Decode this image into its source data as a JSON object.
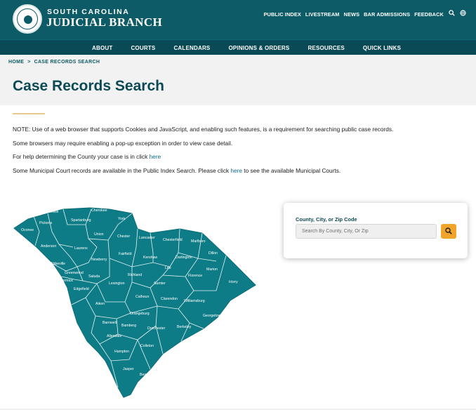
{
  "header": {
    "brand_top": "SOUTH CAROLINA",
    "brand_main": "JUDICIAL BRANCH",
    "utility_links": [
      "PUBLIC INDEX",
      "LIVESTREAM",
      "NEWS",
      "BAR ADMISSIONS",
      "FEEDBACK"
    ],
    "icons": [
      "search-icon",
      "globe-icon"
    ]
  },
  "nav": {
    "items": [
      "ABOUT",
      "COURTS",
      "CALENDARS",
      "OPINIONS & ORDERS",
      "RESOURCES",
      "QUICK LINKS"
    ]
  },
  "breadcrumb": {
    "home": "HOME",
    "separator": ">",
    "current": "CASE RECORDS SEARCH"
  },
  "page": {
    "title": "Case Records Search"
  },
  "notes": {
    "note1": "NOTE: Use of a web browser that supports Cookies and JavaScript, and enabling such features, is a requirement for searching public case records.",
    "note2": "Some browsers may require enabling a pop-up exception in order to view case detail.",
    "note3_text": "For help determining the County your case is in click ",
    "note3_link": "here",
    "note4_text": "Some Municipal Court records are available in the Public Index Search. Please click ",
    "note4_link": "here",
    "note4_tail": " to see the available Municipal Courts."
  },
  "map": {
    "counties": [
      "Greenville",
      "Cherokee",
      "Pickens",
      "Spartanburg",
      "York",
      "Oconee",
      "Union",
      "Chester",
      "Lancaster",
      "Chesterfield",
      "Marlboro",
      "Anderson",
      "Laurens",
      "Fairfield",
      "Kershaw",
      "Darlington",
      "Dillon",
      "Newberry",
      "Lee",
      "Marion",
      "Abbeville",
      "Greenwood",
      "Saluda",
      "Richland",
      "Florence",
      "McCormick",
      "Lexington",
      "Sumter",
      "Horry",
      "Edgefield",
      "Calhoun",
      "Clarendon",
      "Williamsburg",
      "Aiken",
      "Orangeburg",
      "Georgetown",
      "Barnwell",
      "Bamberg",
      "Dorchester",
      "Berkeley",
      "Allendale",
      "Colleton",
      "Charleston",
      "Hampton",
      "Jasper",
      "Beaufort"
    ],
    "fill_color": "#0e7c86"
  },
  "search": {
    "label": "County, City, or Zip Code",
    "placeholder": "Search By County, City, Or Zip",
    "value": "",
    "button_icon": "search-icon",
    "button_color": "#f0a52a"
  },
  "colors": {
    "header_bg": "#0c5b66",
    "nav_bg": "#0a4a56",
    "title": "#0c4a55",
    "link": "#0c6c86",
    "accent": "#e9c98c"
  }
}
